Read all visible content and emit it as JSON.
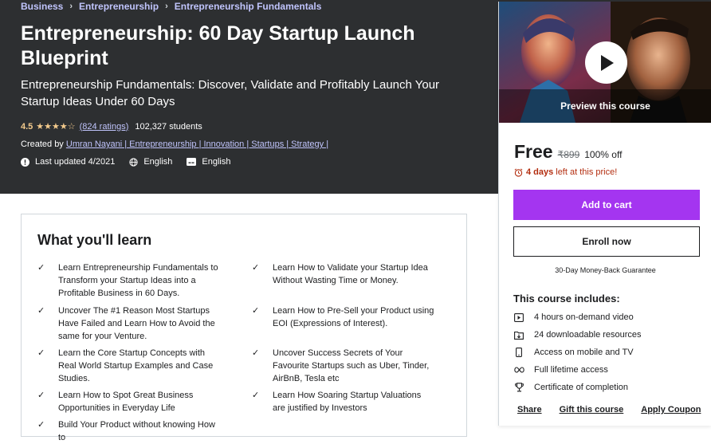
{
  "breadcrumb": [
    "Business",
    "Entrepreneurship",
    "Entrepreneurship Fundamentals"
  ],
  "course": {
    "title": "Entrepreneurship: 60 Day Startup Launch Blueprint",
    "subtitle": "Entrepreneurship Fundamentals: Discover, Validate and Profitably Launch Your Startup Ideas Under 60 Days",
    "rating": "4.5",
    "stars": "★★★★☆",
    "ratings_count": "(824 ratings)",
    "students": "102,327 students",
    "created_by_label": "Created by",
    "instructor": "Umran Nayani | Entrepreneurship | Innovation | Startups | Strategy |",
    "last_updated": "Last updated 4/2021",
    "language": "English",
    "captions": "English"
  },
  "learn": {
    "title": "What you'll learn",
    "items": [
      "Learn Entrepreneurship Fundamentals to Transform your Startup Ideas into a Profitable Business in 60 Days.",
      "Learn How to Validate your Startup Idea Without Wasting Time or Money.",
      "Uncover The #1 Reason Most Startups Have Failed and Learn How to Avoid the same for your Venture.",
      "Learn How to Pre-Sell your Product using EOI (Expressions of Interest).",
      "Learn the Core Startup Concepts with Real World Startup Examples and Case Studies.",
      "Uncover Success Secrets of Your Favourite Startups such as Uber, Tinder, AirBnB, Tesla etc",
      "Learn How to Spot Great Business Opportunities in Everyday Life",
      "Learn How Soaring Startup Valuations are justified by Investors",
      "Build Your Product without knowing How to"
    ]
  },
  "sidebar": {
    "preview_label": "Preview this course",
    "price": "Free",
    "original_price": "₹899",
    "discount": "100% off",
    "timer_days": "4 days",
    "timer_text": "left at this price!",
    "add_to_cart": "Add to cart",
    "enroll_now": "Enroll now",
    "guarantee": "30-Day Money-Back Guarantee",
    "includes_title": "This course includes:",
    "includes": [
      {
        "icon": "video-icon",
        "text": "4 hours on-demand video"
      },
      {
        "icon": "file-icon",
        "text": "24 downloadable resources"
      },
      {
        "icon": "mobile-icon",
        "text": "Access on mobile and TV"
      },
      {
        "icon": "infinity-icon",
        "text": "Full lifetime access"
      },
      {
        "icon": "trophy-icon",
        "text": "Certificate of completion"
      }
    ],
    "actions": [
      "Share",
      "Gift this course",
      "Apply Coupon"
    ]
  }
}
